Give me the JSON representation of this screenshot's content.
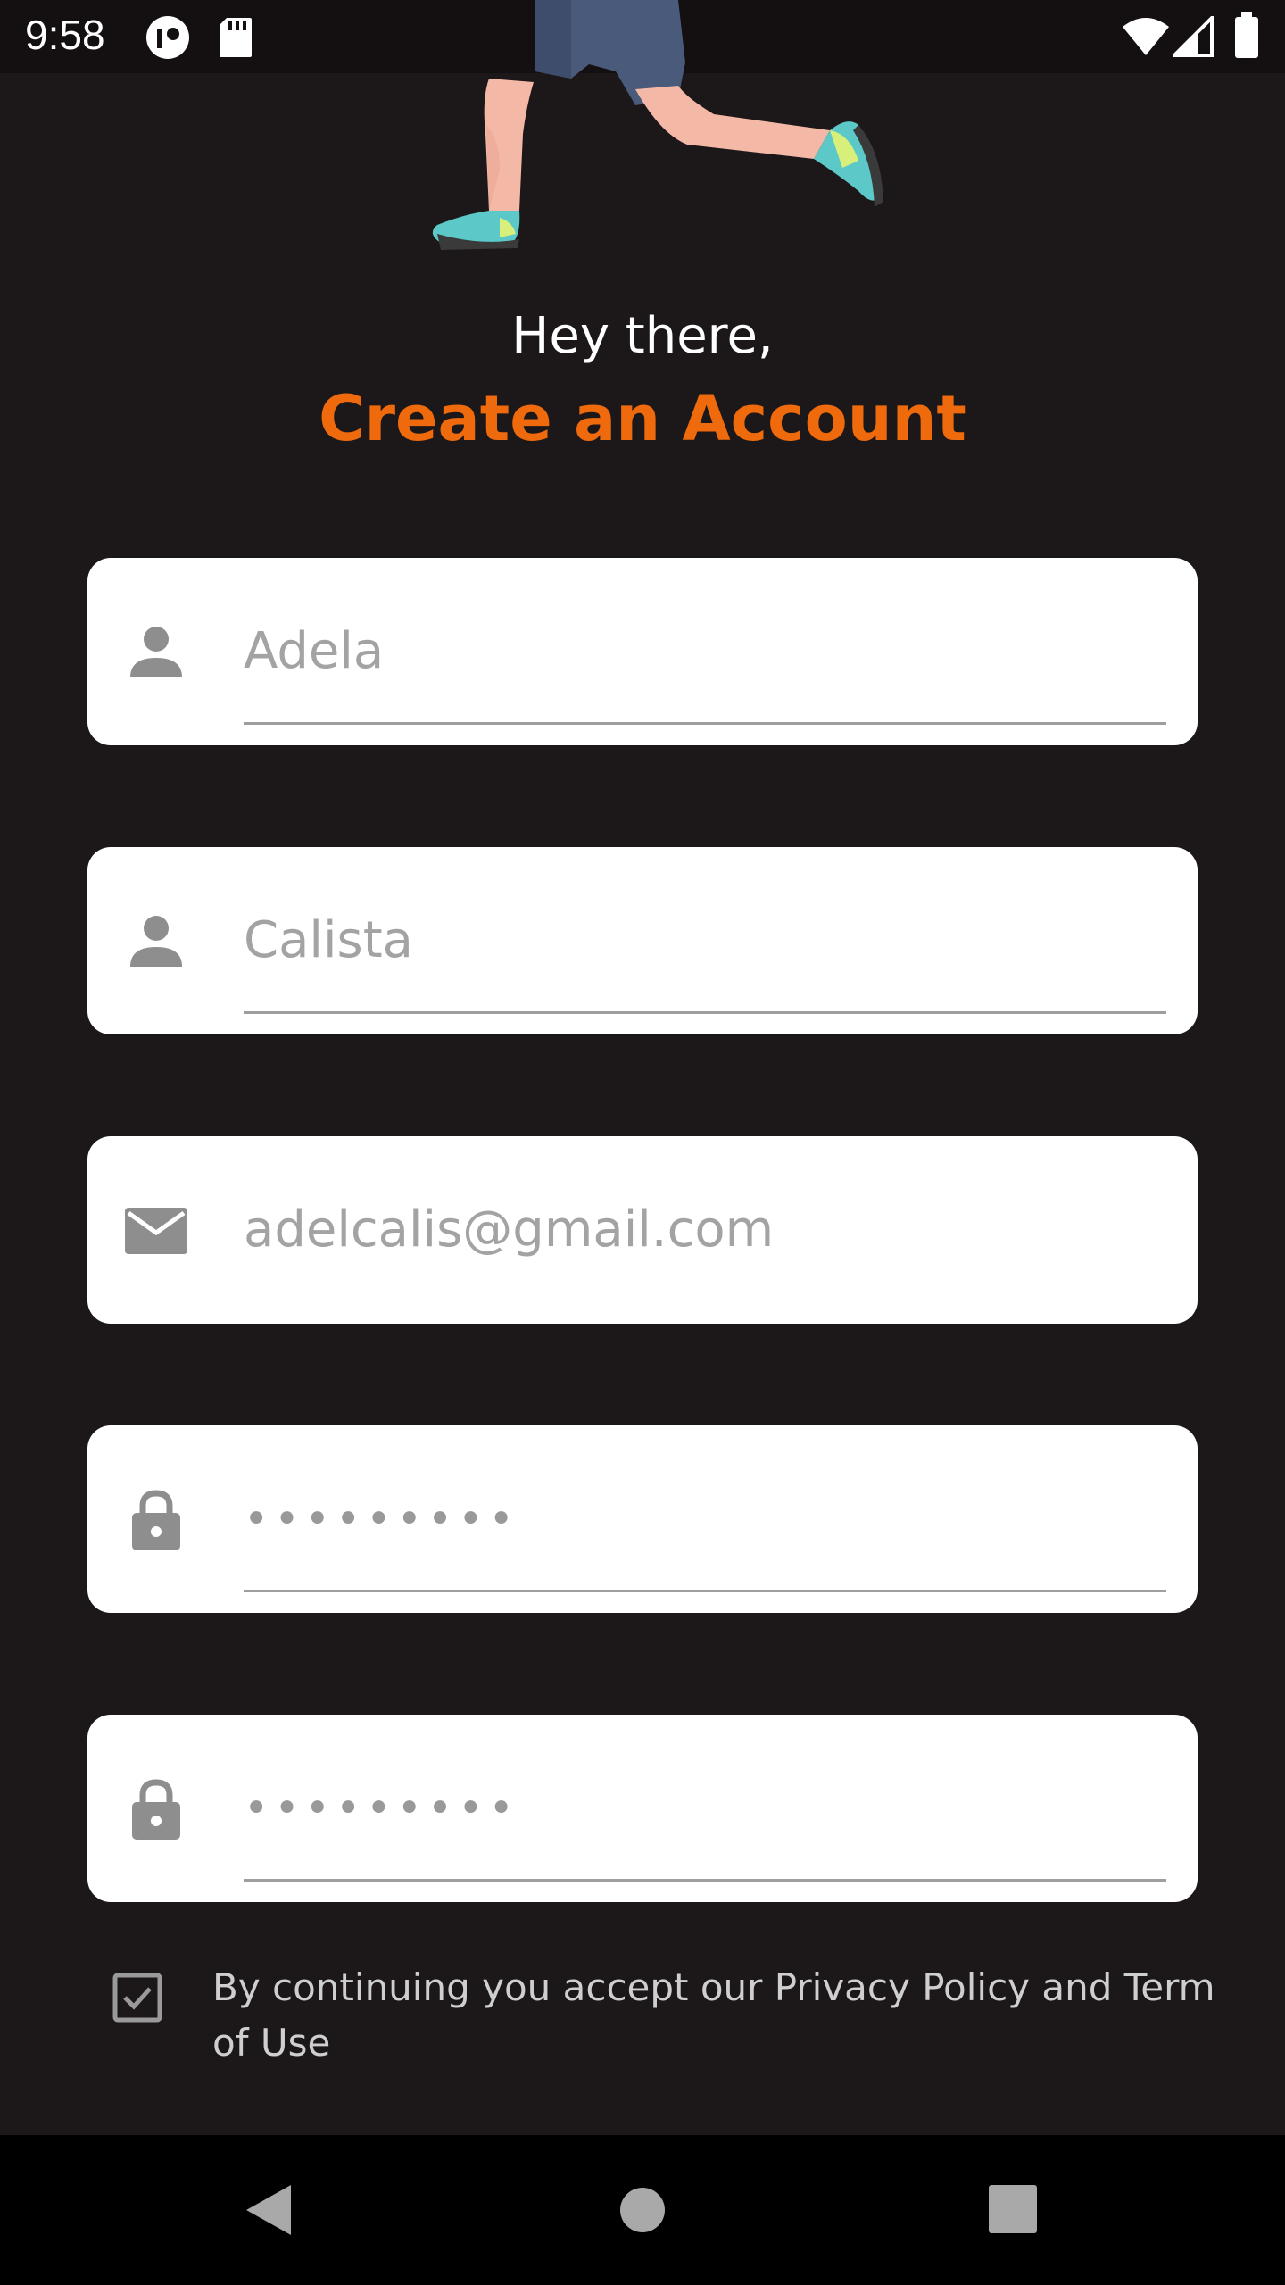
{
  "status_bar": {
    "time": "9:58",
    "icons": [
      "app-notification-icon",
      "sd-card-icon",
      "wifi-icon",
      "cellular-signal-icon",
      "battery-icon"
    ]
  },
  "header": {
    "greeting": "Hey there,",
    "title": "Create an Account"
  },
  "form": {
    "fields": [
      {
        "icon": "person-icon",
        "value": "Adela"
      },
      {
        "icon": "person-icon",
        "value": "Calista"
      },
      {
        "icon": "mail-icon",
        "value": "adelcalis@gmail.com"
      },
      {
        "icon": "lock-icon",
        "value": "•••••••••"
      },
      {
        "icon": "lock-icon",
        "value": "•••••••••"
      }
    ],
    "consent": {
      "checked": true,
      "text": "By continuing you accept our Privacy Policy and Term of Use"
    }
  },
  "nav_bar": {
    "buttons": [
      "back-icon",
      "home-icon",
      "recents-icon"
    ]
  },
  "colors": {
    "background": "#1c1718",
    "accent": "#ee6a0c",
    "field_background": "#ffffff",
    "field_text": "#a3a3a3",
    "icon_gray": "#8e8e8e"
  }
}
